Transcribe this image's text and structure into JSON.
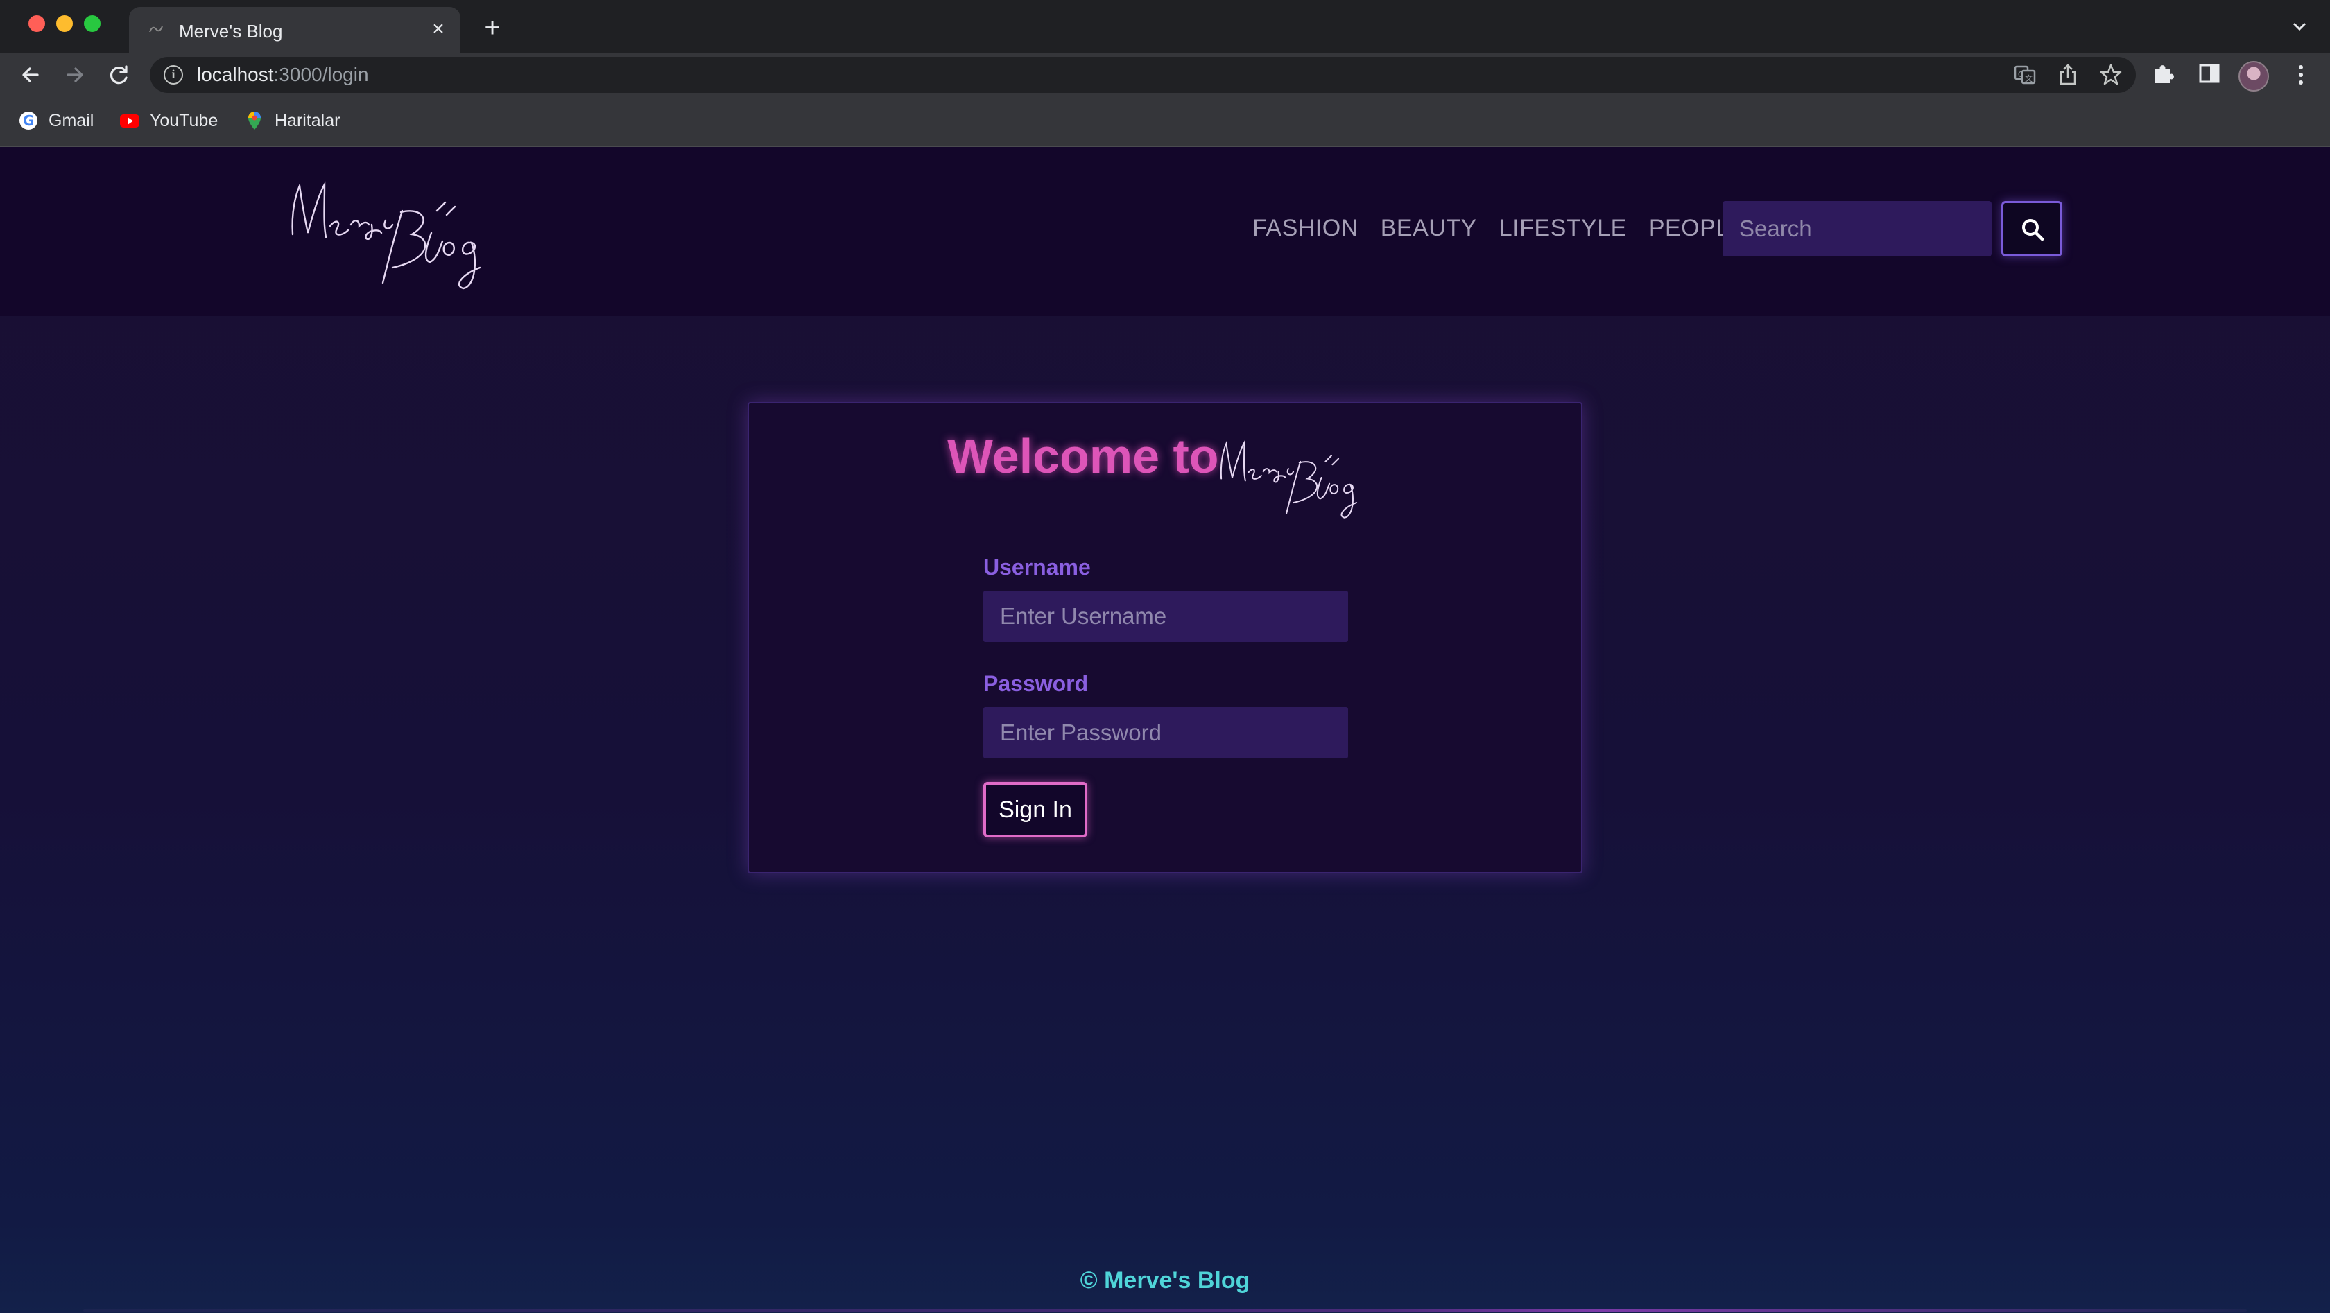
{
  "browser": {
    "tab_title": "Merve's Blog",
    "url_host": "localhost",
    "url_path": ":3000/login",
    "bookmarks": [
      {
        "label": "Gmail",
        "icon": "google-icon"
      },
      {
        "label": "YouTube",
        "icon": "youtube-icon"
      },
      {
        "label": "Haritalar",
        "icon": "maps-icon"
      }
    ]
  },
  "site": {
    "logo_text": "Merve's Blog",
    "nav": [
      "FASHION",
      "BEAUTY",
      "LIFESTYLE",
      "PEOPLE"
    ],
    "search_placeholder": "Search"
  },
  "login": {
    "welcome": "Welcome to",
    "username_label": "Username",
    "username_placeholder": "Enter Username",
    "password_label": "Password",
    "password_placeholder": "Enter Password",
    "signin_label": "Sign In"
  },
  "footer": {
    "text": "© Merve's Blog"
  },
  "colors": {
    "accent_pink": "#dd55b8",
    "accent_purple": "#8a5fe0",
    "footer_cyan": "#4fd4d8",
    "header_bg": "#13062a"
  }
}
